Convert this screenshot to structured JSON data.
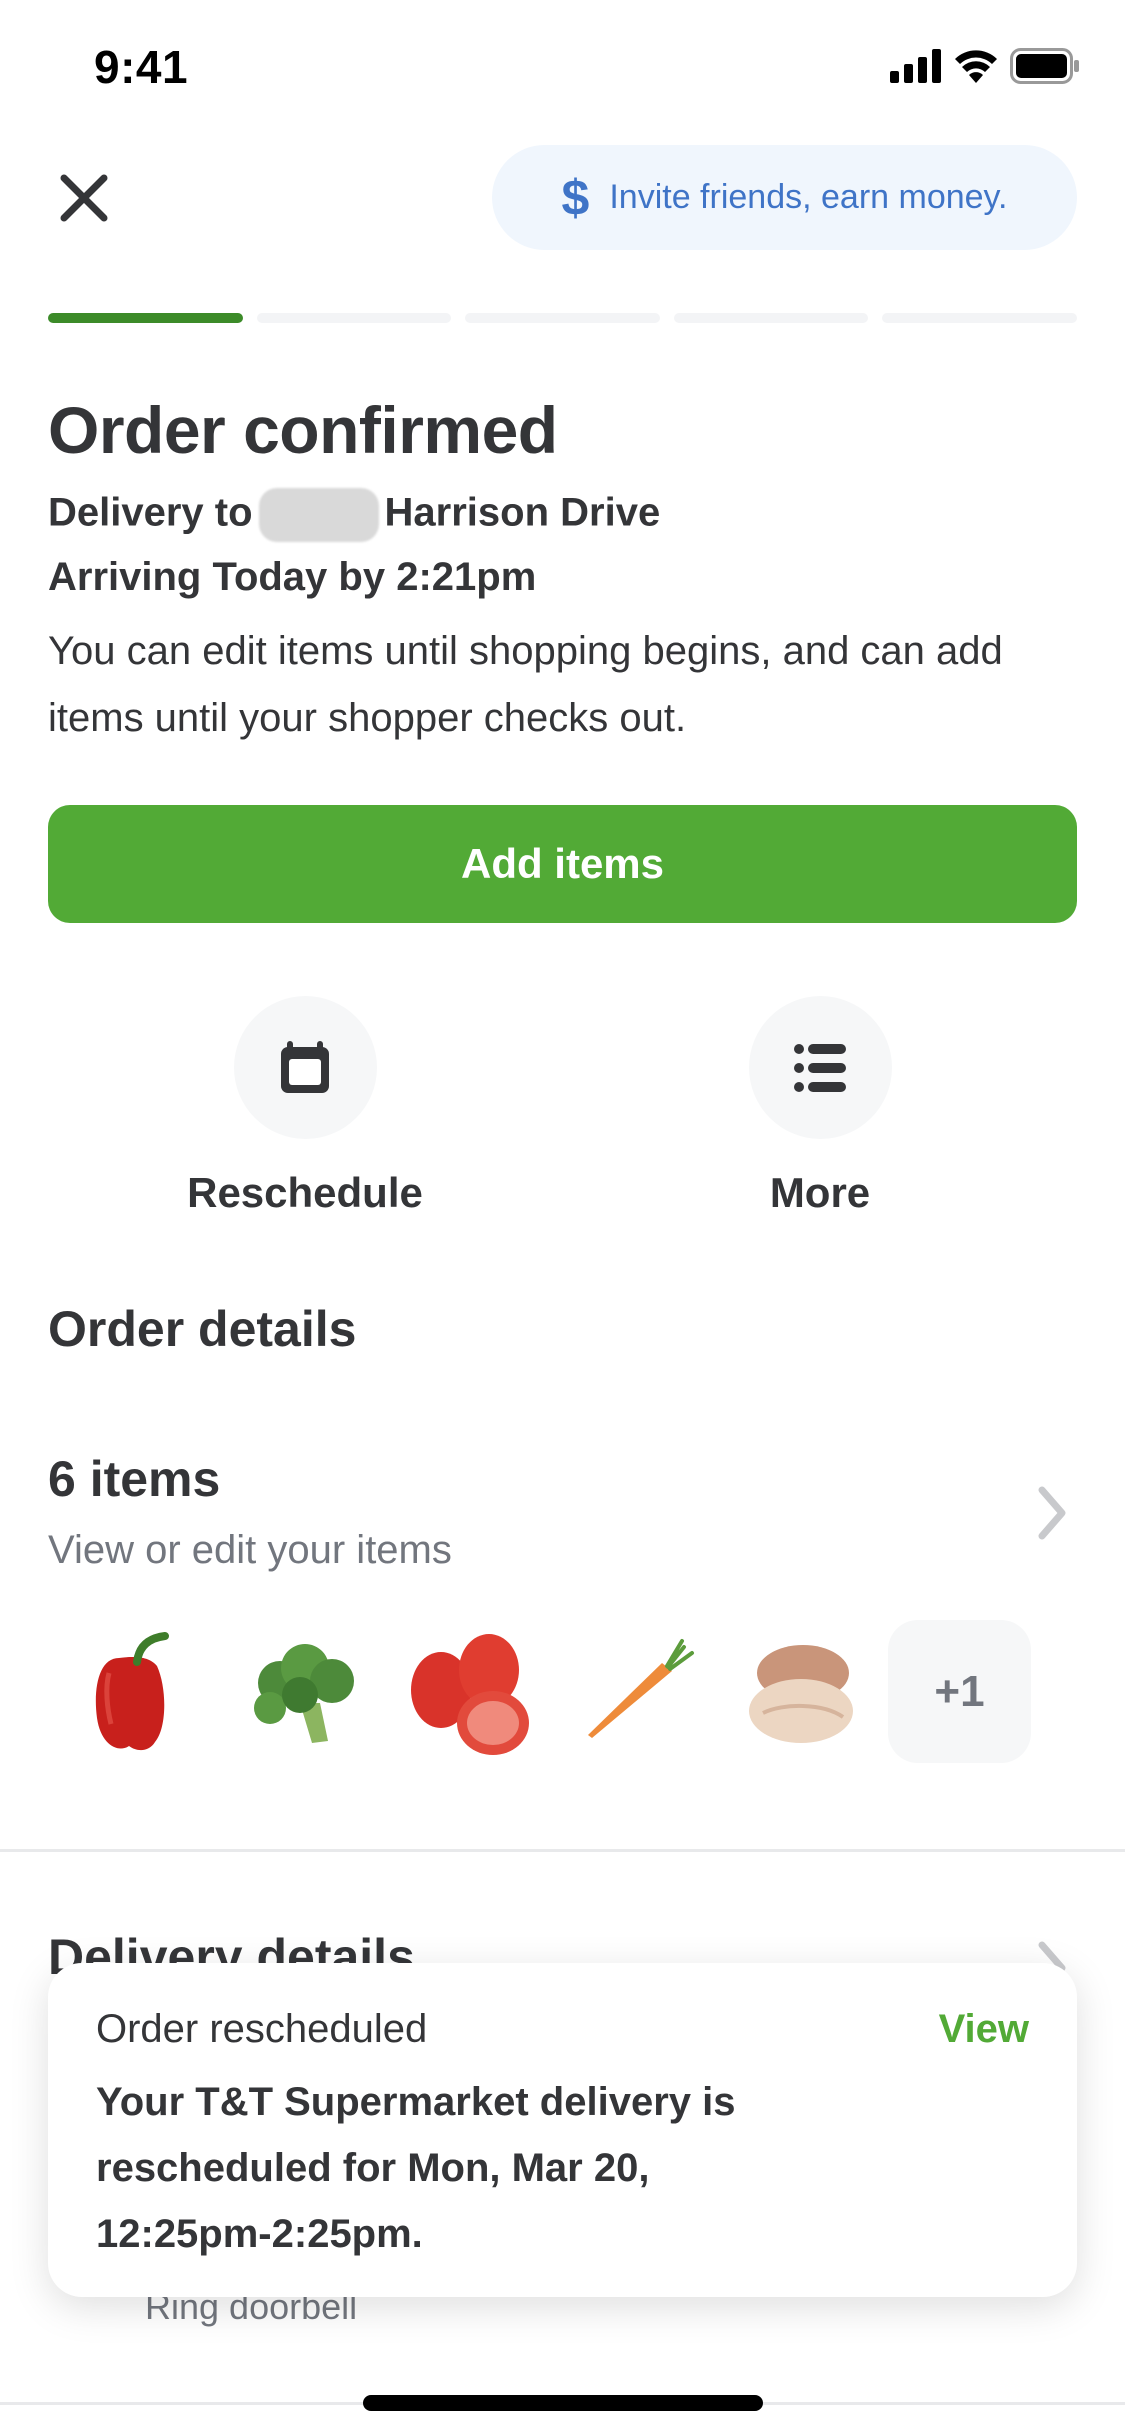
{
  "status_bar": {
    "time": "9:41",
    "icons": [
      "cellular-signal-icon",
      "wifi-icon",
      "battery-icon"
    ]
  },
  "header": {
    "close_icon": "close-icon",
    "invite": {
      "icon": "dollar-icon",
      "icon_glyph": "$",
      "label": "Invite friends, earn money."
    }
  },
  "progress": {
    "total_steps": 5,
    "completed_steps": 1,
    "active_color": "#3c8b29",
    "inactive_color": "#f3f4f6"
  },
  "order": {
    "title": "Order confirmed",
    "delivery_prefix": "Delivery to",
    "delivery_street": "Harrison Drive",
    "arrival": "Arriving Today by 2:21pm",
    "description": "You can edit items until shopping begins, and can add items until your shopper checks out.",
    "add_items_label": "Add items",
    "accent_color": "#52aa36"
  },
  "actions": [
    {
      "label": "Reschedule",
      "icon": "calendar-icon"
    },
    {
      "label": "More",
      "icon": "list-icon"
    }
  ],
  "order_details": {
    "heading": "Order details",
    "items_count": "6 items",
    "items_subtitle": "View or edit your items",
    "thumbnails": [
      {
        "name": "red bell pepper",
        "icon": "bell-pepper-icon"
      },
      {
        "name": "broccoli",
        "icon": "broccoli-icon"
      },
      {
        "name": "tomatoes",
        "icon": "tomato-icon"
      },
      {
        "name": "carrot",
        "icon": "carrot-icon"
      },
      {
        "name": "chicken breast",
        "icon": "chicken-icon"
      }
    ],
    "more_count": "+1"
  },
  "delivery_details": {
    "heading": "Delivery details",
    "instruction": "Ring doorbell"
  },
  "toast": {
    "title": "Order rescheduled",
    "action": "View",
    "body": "Your T&T Supermarket delivery is rescheduled for Mon, Mar 20, 12:25pm-2:25pm."
  }
}
